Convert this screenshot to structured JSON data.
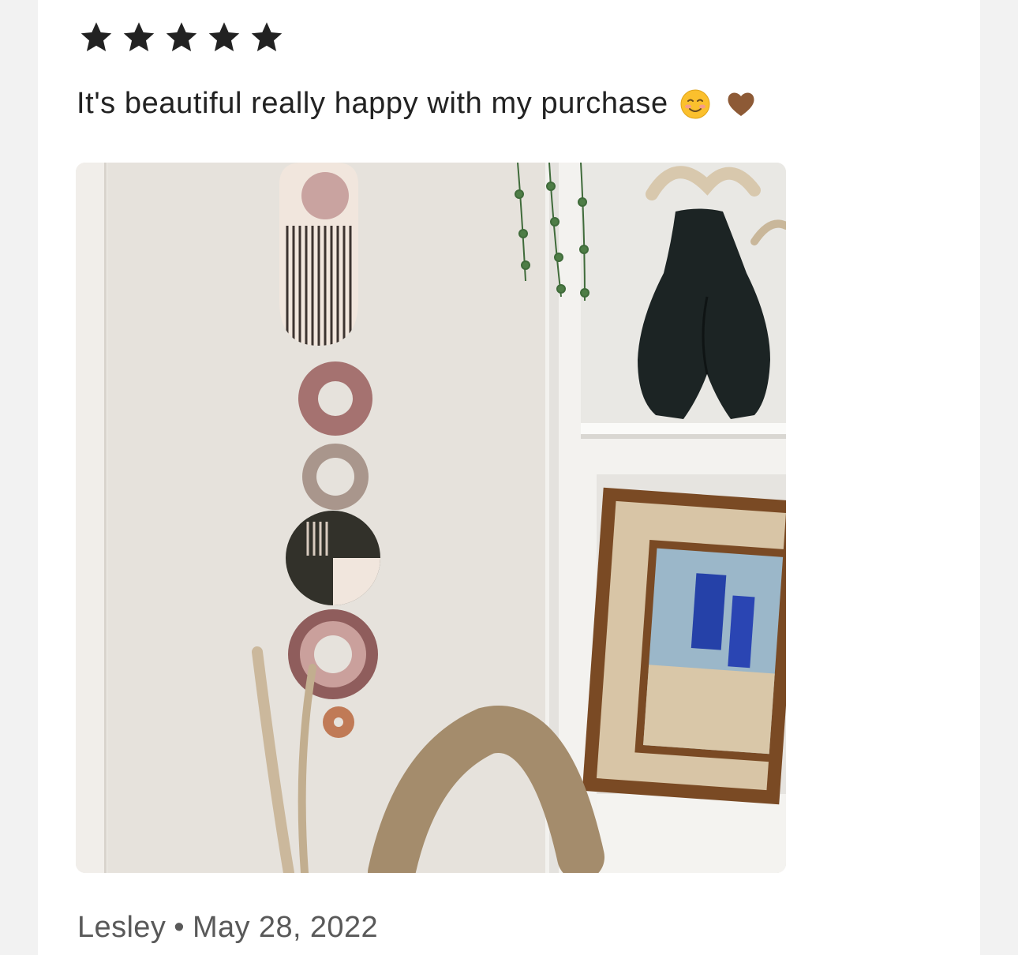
{
  "review": {
    "rating": 5,
    "rating_max": 5,
    "text": "It's beautiful really happy with my purchase",
    "emojis": [
      "smiling-face-emoji",
      "brown-heart-emoji"
    ],
    "author": "Lesley",
    "separator": "•",
    "date": "May 28, 2022"
  },
  "photo": {
    "subject": "review-photo",
    "icon": "review-photo"
  },
  "colors": {
    "star": "#222222",
    "text": "#222222",
    "meta": "#595959",
    "card_bg": "#ffffff",
    "page_bg": "#f2f2f2"
  }
}
